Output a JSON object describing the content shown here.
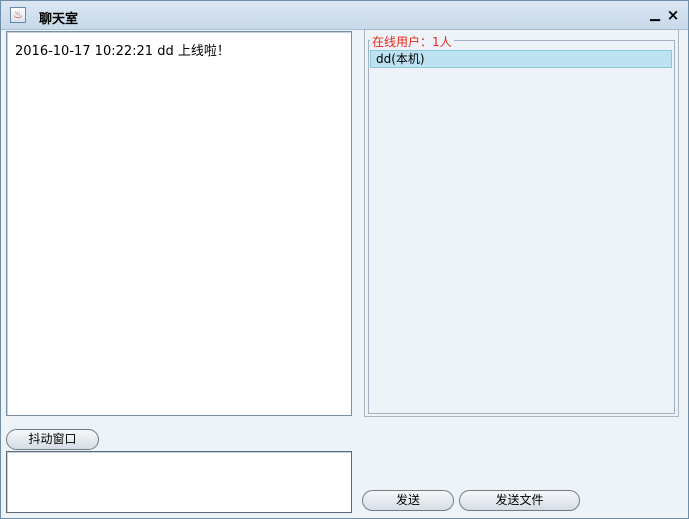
{
  "window": {
    "title": "聊天室",
    "app_icon": "java-cup-icon",
    "minimize_label": "▁",
    "close_label": "×"
  },
  "chat": {
    "messages": [
      "2016-10-17 10:22:21 dd 上线啦！"
    ]
  },
  "users": {
    "group_label": "在线用户：1人",
    "group_label_color": "#e8281a",
    "items": [
      {
        "label": "dd(本机)",
        "selected": true
      }
    ]
  },
  "buttons": {
    "shake": "抖动窗口",
    "send": "发送",
    "send_file": "发送文件"
  },
  "input": {
    "value": ""
  }
}
